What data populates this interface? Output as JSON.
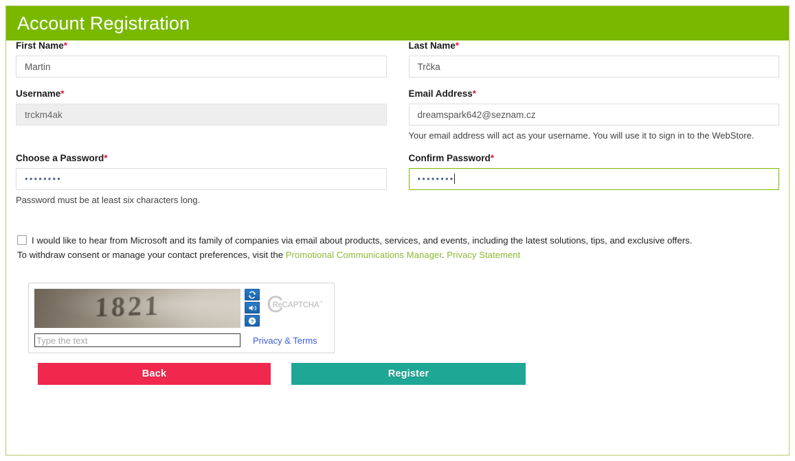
{
  "header": {
    "title": "Account Registration",
    "background_color": "#7ab800"
  },
  "form": {
    "first_name": {
      "label": "First Name",
      "required_marker": "*",
      "value": "Martin"
    },
    "last_name": {
      "label": "Last Name",
      "required_marker": "*",
      "value": "Trčka"
    },
    "username": {
      "label": "Username",
      "required_marker": "*",
      "value": "trckm4ak",
      "readonly": true
    },
    "email": {
      "label": "Email Address",
      "required_marker": "*",
      "value": "dreamspark642@seznam.cz",
      "help": "Your email address will act as your username. You will use it to sign in to the WebStore."
    },
    "password": {
      "label": "Choose a Password",
      "required_marker": "*",
      "value": "••••••••",
      "help": "Password must be at least six characters long."
    },
    "confirm_password": {
      "label": "Confirm Password",
      "required_marker": "*",
      "value": "••••••••",
      "focused": true
    }
  },
  "consent": {
    "line1": "I would like to hear from Microsoft and its family of companies via email about products, services, and events, including the latest solutions, tips, and exclusive offers.",
    "line2_prefix": "To withdraw consent or manage your contact preferences, visit the ",
    "link1": "Promotional Communications Manager",
    "line2_separator": ". ",
    "link2": "Privacy Statement",
    "checked": false,
    "link_color": "#8cba36"
  },
  "captcha": {
    "challenge_text": "1821",
    "input_placeholder": "Type the text",
    "input_value": "",
    "refresh_icon": "refresh-icon",
    "audio_icon": "audio-icon",
    "help_icon": "help-icon",
    "brand_c": "C",
    "brand_re": "Re",
    "brand_name": "CAPTCHA",
    "brand_tm": "™",
    "privacy_terms_label": "Privacy & Terms",
    "privacy_terms_color": "#3b5bdb"
  },
  "actions": {
    "back_label": "Back",
    "back_color": "#f0284d",
    "register_label": "Register",
    "register_color": "#1fa795"
  }
}
